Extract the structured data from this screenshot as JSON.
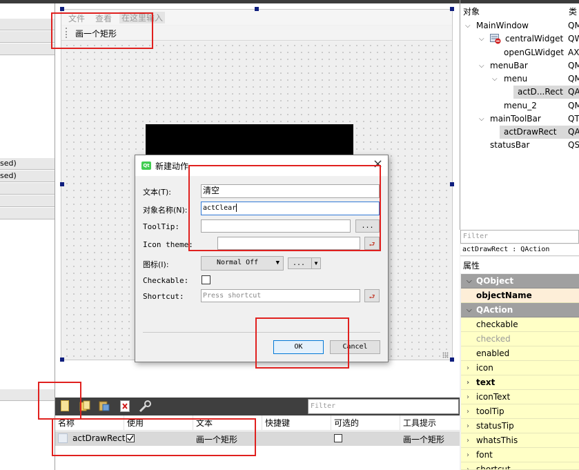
{
  "form_menu": {
    "items": [
      "文件",
      "查看",
      "在这里输入"
    ]
  },
  "form_toolbar": {
    "action": "画一个矩形"
  },
  "left_panel": {
    "rows": [
      "sed)",
      "sed)"
    ]
  },
  "object_inspector": {
    "col_object": "对象",
    "col_class": "类",
    "rows": [
      {
        "name": "MainWindow",
        "cls": "QM"
      },
      {
        "name": "centralWidget",
        "cls": "QW"
      },
      {
        "name": "openGLWidget",
        "cls": "AX"
      },
      {
        "name": "menuBar",
        "cls": "QM"
      },
      {
        "name": "menu",
        "cls": "QM"
      },
      {
        "name": "actD...Rect",
        "cls": "QA"
      },
      {
        "name": "menu_2",
        "cls": "QM"
      },
      {
        "name": "mainToolBar",
        "cls": "QT"
      },
      {
        "name": "actDrawRect",
        "cls": "QA"
      },
      {
        "name": "statusBar",
        "cls": "QS"
      }
    ]
  },
  "property_editor": {
    "filter_placeholder": "Filter",
    "object_line": "actDrawRect : QAction",
    "header": "属性",
    "rows": [
      {
        "label": "QObject",
        "kind": "hdr"
      },
      {
        "label": "objectName",
        "kind": "oname"
      },
      {
        "label": "QAction",
        "kind": "hdr"
      },
      {
        "label": "checkable",
        "kind": "yellow"
      },
      {
        "label": "checked",
        "kind": "yellow-disabled"
      },
      {
        "label": "enabled",
        "kind": "yellow"
      },
      {
        "label": "icon",
        "kind": "yellow-exp"
      },
      {
        "label": "text",
        "kind": "yellow-exp-bold"
      },
      {
        "label": "iconText",
        "kind": "yellow-exp"
      },
      {
        "label": "toolTip",
        "kind": "yellow-exp"
      },
      {
        "label": "statusTip",
        "kind": "yellow-exp"
      },
      {
        "label": "whatsThis",
        "kind": "yellow-exp"
      },
      {
        "label": "font",
        "kind": "yellow-exp"
      },
      {
        "label": "shortcut",
        "kind": "yellow-exp"
      }
    ]
  },
  "action_editor": {
    "filter_placeholder": "Filter",
    "columns": [
      "名称",
      "使用",
      "文本",
      "快捷键",
      "可选的",
      "工具提示"
    ],
    "row": {
      "name": "actDrawRect",
      "used": true,
      "text": "画一个矩形",
      "shortcut": "",
      "checkable": false,
      "tooltip": "画一个矩形"
    }
  },
  "dialog": {
    "title": "新建动作",
    "close": "×",
    "text_label": "文本(T):",
    "text_value": "清空",
    "objname_label": "对象名称(N):",
    "objname_value": "actClear",
    "tooltip_label": "ToolTip:",
    "tooltip_value": "",
    "icontheme_label": "Icon theme:",
    "icontheme_value": "",
    "icon_label": "图标(I):",
    "icon_mode": "Normal Off",
    "icon_more": "...",
    "checkable_label": "Checkable:",
    "shortcut_label": "Shortcut:",
    "shortcut_placeholder": "Press shortcut",
    "ellipsis": "...",
    "ok": "OK",
    "cancel": "Cancel"
  },
  "colors": {
    "highlight": "#e0201e",
    "prop_yellow": "#ffffc6",
    "prop_header": "#a0a0a0",
    "toolbar_dark": "#3f3f3f"
  }
}
